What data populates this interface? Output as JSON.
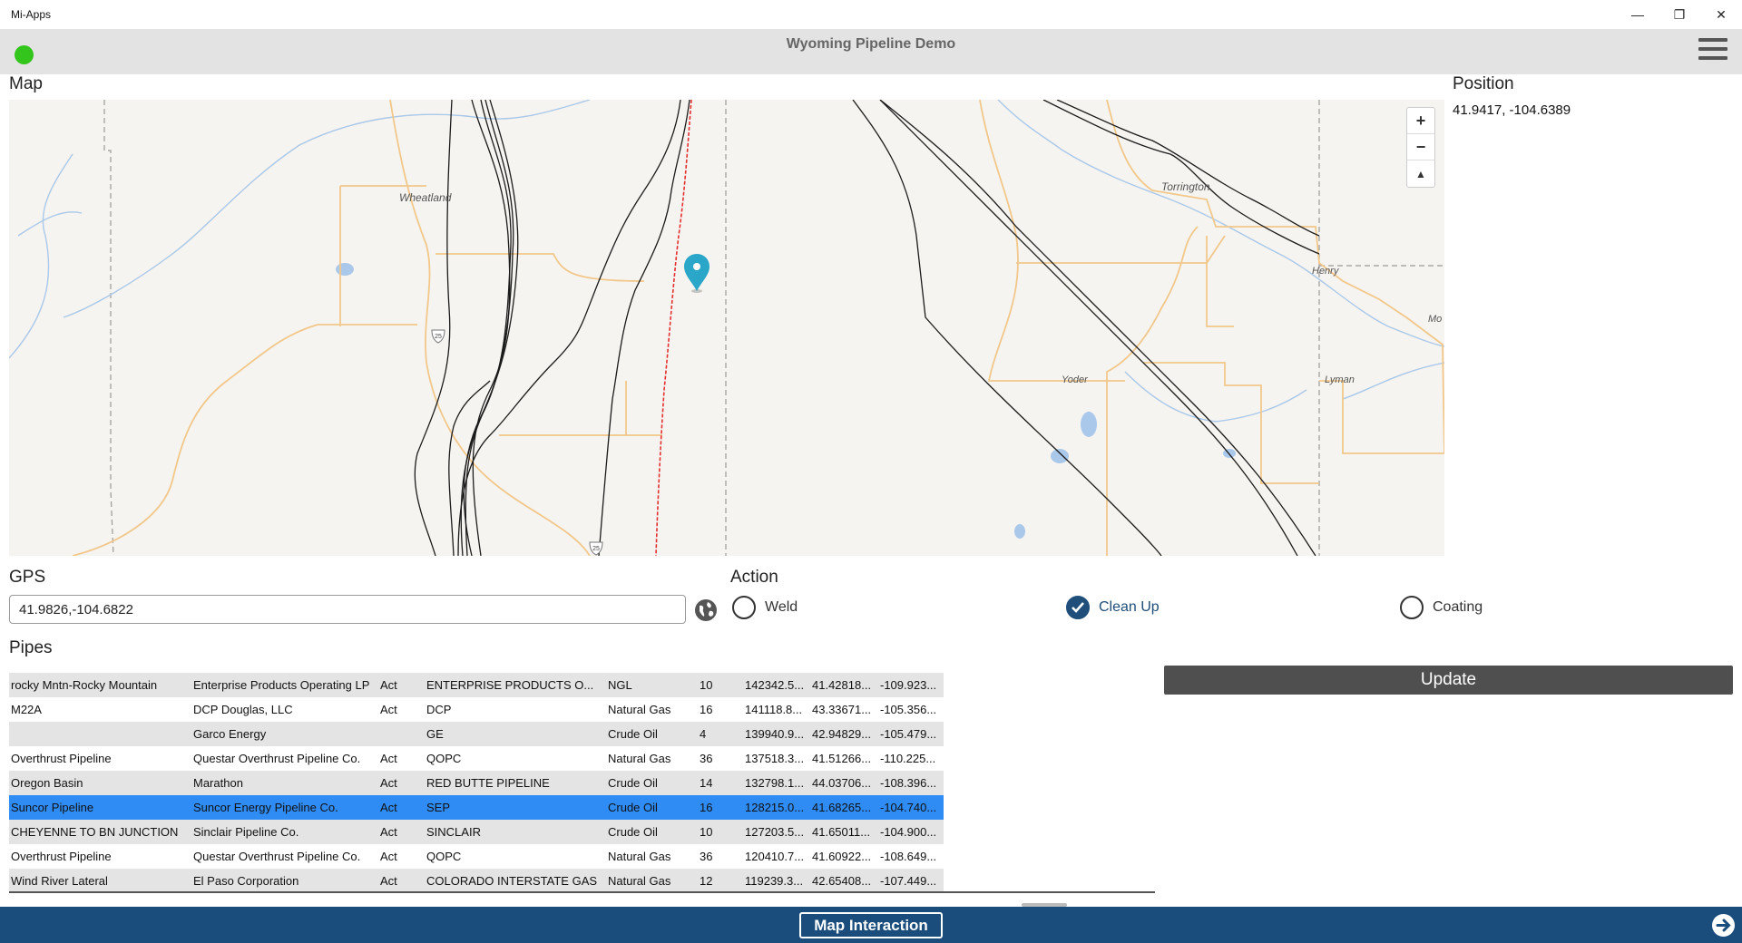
{
  "window": {
    "app_name": "Mi-Apps",
    "minimize_glyph": "—",
    "restore_glyph": "❐",
    "close_glyph": "✕"
  },
  "header": {
    "title": "Wyoming Pipeline Demo",
    "status_color": "#34c51c"
  },
  "map_section": {
    "label": "Map",
    "zoom_in": "+",
    "zoom_out": "−",
    "reset_bearing": "▲",
    "place_labels": {
      "wheatland": "Wheatland",
      "torrington": "Torrington",
      "henry": "Henry",
      "yoder": "Yoder",
      "lyman": "Lyman",
      "mo": "Mo"
    },
    "shield": "25",
    "marker_color": "#2aa6c9",
    "highlight_color": "#e53030"
  },
  "position": {
    "label": "Position",
    "value": "41.9417, -104.6389"
  },
  "gps": {
    "label": "GPS",
    "value": "41.9826,-104.6822"
  },
  "action": {
    "label": "Action",
    "options": [
      {
        "label": "Weld",
        "checked": false
      },
      {
        "label": "Clean Up",
        "checked": true
      },
      {
        "label": "Coating",
        "checked": false
      }
    ]
  },
  "pipes": {
    "label": "Pipes",
    "rows": [
      [
        "rocky Mntn-Rocky Mountain",
        "Enterprise Products Operating LP",
        "Act",
        "ENTERPRISE PRODUCTS O...",
        "NGL",
        "10",
        "142342.5...",
        "41.42818...",
        "-109.923..."
      ],
      [
        "M22A",
        "DCP Douglas, LLC",
        "Act",
        "DCP",
        "Natural Gas",
        "16",
        "141118.8...",
        "43.33671...",
        "-105.356..."
      ],
      [
        "",
        "Garco Energy",
        "",
        "GE",
        "Crude Oil",
        "4",
        "139940.9...",
        "42.94829...",
        "-105.479..."
      ],
      [
        "Overthrust Pipeline",
        "Questar Overthrust Pipeline Co.",
        "Act",
        "QOPC",
        "Natural Gas",
        "36",
        "137518.3...",
        "41.51266...",
        "-110.225..."
      ],
      [
        "Oregon Basin",
        "Marathon",
        "Act",
        "RED BUTTE PIPELINE",
        "Crude Oil",
        "14",
        "132798.1...",
        "44.03706...",
        "-108.396..."
      ],
      [
        "Suncor Pipeline",
        "Suncor Energy Pipeline Co.",
        "Act",
        "SEP",
        "Crude Oil",
        "16",
        "128215.0...",
        "41.68265...",
        "-104.740..."
      ],
      [
        "CHEYENNE TO BN JUNCTION",
        "Sinclair Pipeline Co.",
        "Act",
        "SINCLAIR",
        "Crude Oil",
        "10",
        "127203.5...",
        "41.65011...",
        "-104.900..."
      ],
      [
        "Overthrust Pipeline",
        "Questar Overthrust Pipeline Co.",
        "Act",
        "QOPC",
        "Natural Gas",
        "36",
        "120410.7...",
        "41.60922...",
        "-108.649..."
      ],
      [
        "Wind River Lateral",
        "El Paso Corporation",
        "Act",
        "COLORADO INTERSTATE GAS",
        "Natural Gas",
        "12",
        "119239.3...",
        "42.65408...",
        "-107.449..."
      ]
    ],
    "selected_row": 5
  },
  "update_button": "Update",
  "footer": {
    "button": "Map Interaction"
  }
}
